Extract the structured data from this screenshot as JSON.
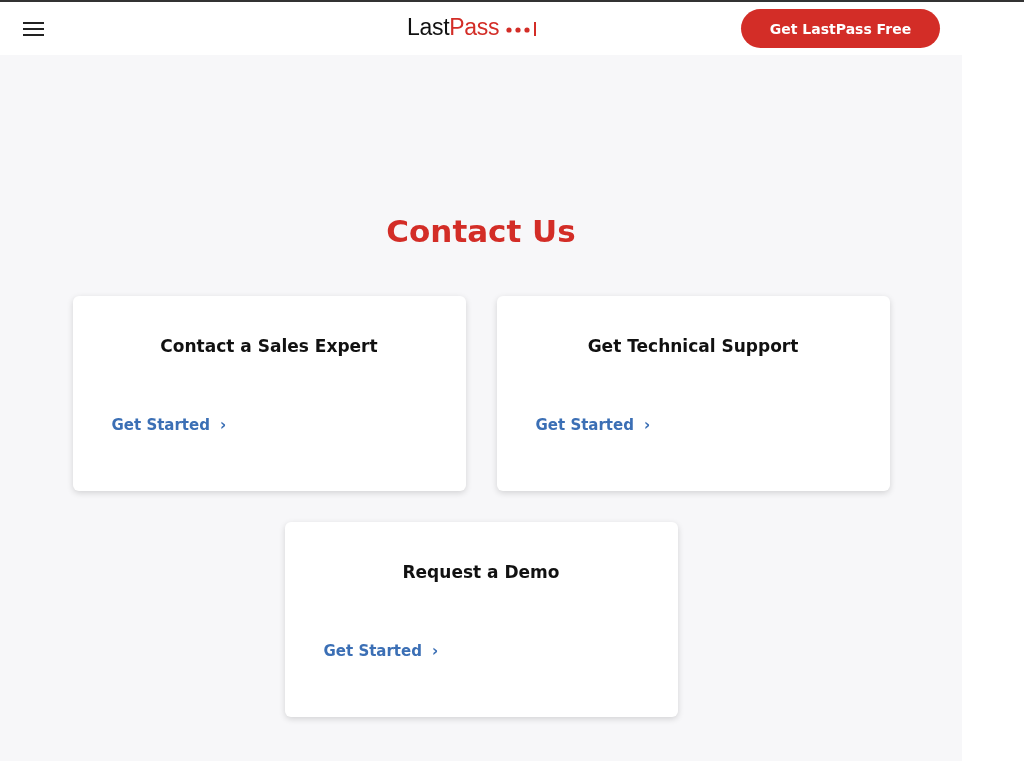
{
  "header": {
    "logo": [
      {
        "text": "Last",
        "accent": false
      },
      {
        "text": "Pass",
        "accent": true
      }
    ],
    "cta": "Get LastPass Free"
  },
  "title": "Contact Us",
  "cards": [
    {
      "title": "Contact a Sales Expert",
      "link": "Get Started",
      "arrow": "›"
    },
    {
      "title": "Get Technical Support",
      "link": "Get Started",
      "arrow": "›"
    },
    {
      "title": "Request a Demo",
      "link": "Get Started",
      "arrow": "›"
    }
  ]
}
